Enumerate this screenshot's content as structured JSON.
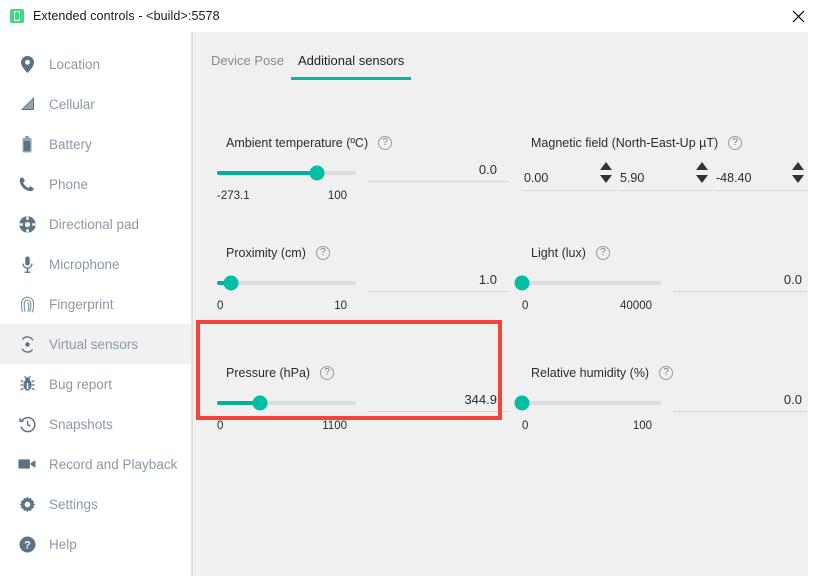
{
  "window": {
    "title": "Extended controls - <build>:5578",
    "app_icon": "android-device-icon",
    "close_icon": "close-icon"
  },
  "sidebar": {
    "items": [
      {
        "label": "Location",
        "icon": "location-pin-icon",
        "selected": false
      },
      {
        "label": "Cellular",
        "icon": "signal-bars-icon",
        "selected": false
      },
      {
        "label": "Battery",
        "icon": "battery-icon",
        "selected": false
      },
      {
        "label": "Phone",
        "icon": "phone-handset-icon",
        "selected": false
      },
      {
        "label": "Directional pad",
        "icon": "dpad-icon",
        "selected": false
      },
      {
        "label": "Microphone",
        "icon": "microphone-icon",
        "selected": false
      },
      {
        "label": "Fingerprint",
        "icon": "fingerprint-icon",
        "selected": false
      },
      {
        "label": "Virtual sensors",
        "icon": "virtual-sensors-icon",
        "selected": true
      },
      {
        "label": "Bug report",
        "icon": "bug-icon",
        "selected": false
      },
      {
        "label": "Snapshots",
        "icon": "history-clock-icon",
        "selected": false
      },
      {
        "label": "Record and Playback",
        "icon": "video-camera-icon",
        "selected": false
      },
      {
        "label": "Settings",
        "icon": "gear-icon",
        "selected": false
      },
      {
        "label": "Help",
        "icon": "question-circle-icon",
        "selected": false
      }
    ]
  },
  "tabs": [
    {
      "label": "Device Pose",
      "active": false
    },
    {
      "label": "Additional sensors",
      "active": true
    }
  ],
  "sensors": {
    "ambient_temperature": {
      "title": "Ambient temperature (ºC)",
      "help_icon": "help-icon",
      "value": "0.0",
      "min": "-273.1",
      "max": "100",
      "knob_percent": 72
    },
    "magnetic_field": {
      "title": "Magnetic field (North-East-Up µT)",
      "help_icon": "help-icon",
      "north": "0.00",
      "east": "5.90",
      "up": "-48.40"
    },
    "proximity": {
      "title": "Proximity (cm)",
      "help_icon": "help-icon",
      "value": "1.0",
      "min": "0",
      "max": "10",
      "knob_percent": 10
    },
    "light": {
      "title": "Light (lux)",
      "help_icon": "help-icon",
      "value": "0.0",
      "min": "0",
      "max": "40000",
      "knob_percent": 0
    },
    "pressure": {
      "title": "Pressure (hPa)",
      "help_icon": "help-icon",
      "value": "344.9",
      "min": "0",
      "max": "1100",
      "knob_percent": 31,
      "highlighted": true
    },
    "relative_humidity": {
      "title": "Relative humidity (%)",
      "help_icon": "help-icon",
      "value": "0.0",
      "min": "0",
      "max": "100",
      "knob_percent": 0
    }
  },
  "colors": {
    "accent_teal": "#00bfa5",
    "highlight_red": "#f4433a",
    "sidebar_text": "#8a99a6",
    "content_bg": "#f0f0f0"
  }
}
